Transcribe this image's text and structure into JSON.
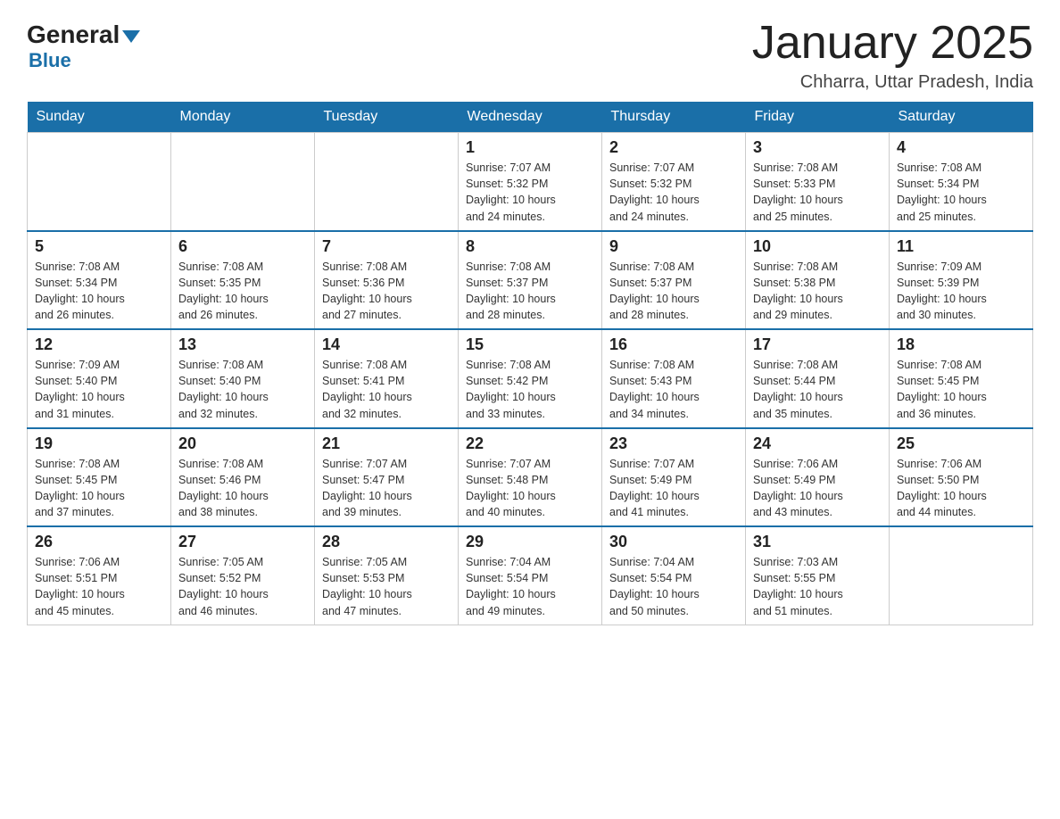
{
  "header": {
    "logo_general": "General",
    "logo_blue": "Blue",
    "month_title": "January 2025",
    "location": "Chharra, Uttar Pradesh, India"
  },
  "weekdays": [
    "Sunday",
    "Monday",
    "Tuesday",
    "Wednesday",
    "Thursday",
    "Friday",
    "Saturday"
  ],
  "weeks": [
    [
      {
        "day": "",
        "info": ""
      },
      {
        "day": "",
        "info": ""
      },
      {
        "day": "",
        "info": ""
      },
      {
        "day": "1",
        "info": "Sunrise: 7:07 AM\nSunset: 5:32 PM\nDaylight: 10 hours\nand 24 minutes."
      },
      {
        "day": "2",
        "info": "Sunrise: 7:07 AM\nSunset: 5:32 PM\nDaylight: 10 hours\nand 24 minutes."
      },
      {
        "day": "3",
        "info": "Sunrise: 7:08 AM\nSunset: 5:33 PM\nDaylight: 10 hours\nand 25 minutes."
      },
      {
        "day": "4",
        "info": "Sunrise: 7:08 AM\nSunset: 5:34 PM\nDaylight: 10 hours\nand 25 minutes."
      }
    ],
    [
      {
        "day": "5",
        "info": "Sunrise: 7:08 AM\nSunset: 5:34 PM\nDaylight: 10 hours\nand 26 minutes."
      },
      {
        "day": "6",
        "info": "Sunrise: 7:08 AM\nSunset: 5:35 PM\nDaylight: 10 hours\nand 26 minutes."
      },
      {
        "day": "7",
        "info": "Sunrise: 7:08 AM\nSunset: 5:36 PM\nDaylight: 10 hours\nand 27 minutes."
      },
      {
        "day": "8",
        "info": "Sunrise: 7:08 AM\nSunset: 5:37 PM\nDaylight: 10 hours\nand 28 minutes."
      },
      {
        "day": "9",
        "info": "Sunrise: 7:08 AM\nSunset: 5:37 PM\nDaylight: 10 hours\nand 28 minutes."
      },
      {
        "day": "10",
        "info": "Sunrise: 7:08 AM\nSunset: 5:38 PM\nDaylight: 10 hours\nand 29 minutes."
      },
      {
        "day": "11",
        "info": "Sunrise: 7:09 AM\nSunset: 5:39 PM\nDaylight: 10 hours\nand 30 minutes."
      }
    ],
    [
      {
        "day": "12",
        "info": "Sunrise: 7:09 AM\nSunset: 5:40 PM\nDaylight: 10 hours\nand 31 minutes."
      },
      {
        "day": "13",
        "info": "Sunrise: 7:08 AM\nSunset: 5:40 PM\nDaylight: 10 hours\nand 32 minutes."
      },
      {
        "day": "14",
        "info": "Sunrise: 7:08 AM\nSunset: 5:41 PM\nDaylight: 10 hours\nand 32 minutes."
      },
      {
        "day": "15",
        "info": "Sunrise: 7:08 AM\nSunset: 5:42 PM\nDaylight: 10 hours\nand 33 minutes."
      },
      {
        "day": "16",
        "info": "Sunrise: 7:08 AM\nSunset: 5:43 PM\nDaylight: 10 hours\nand 34 minutes."
      },
      {
        "day": "17",
        "info": "Sunrise: 7:08 AM\nSunset: 5:44 PM\nDaylight: 10 hours\nand 35 minutes."
      },
      {
        "day": "18",
        "info": "Sunrise: 7:08 AM\nSunset: 5:45 PM\nDaylight: 10 hours\nand 36 minutes."
      }
    ],
    [
      {
        "day": "19",
        "info": "Sunrise: 7:08 AM\nSunset: 5:45 PM\nDaylight: 10 hours\nand 37 minutes."
      },
      {
        "day": "20",
        "info": "Sunrise: 7:08 AM\nSunset: 5:46 PM\nDaylight: 10 hours\nand 38 minutes."
      },
      {
        "day": "21",
        "info": "Sunrise: 7:07 AM\nSunset: 5:47 PM\nDaylight: 10 hours\nand 39 minutes."
      },
      {
        "day": "22",
        "info": "Sunrise: 7:07 AM\nSunset: 5:48 PM\nDaylight: 10 hours\nand 40 minutes."
      },
      {
        "day": "23",
        "info": "Sunrise: 7:07 AM\nSunset: 5:49 PM\nDaylight: 10 hours\nand 41 minutes."
      },
      {
        "day": "24",
        "info": "Sunrise: 7:06 AM\nSunset: 5:49 PM\nDaylight: 10 hours\nand 43 minutes."
      },
      {
        "day": "25",
        "info": "Sunrise: 7:06 AM\nSunset: 5:50 PM\nDaylight: 10 hours\nand 44 minutes."
      }
    ],
    [
      {
        "day": "26",
        "info": "Sunrise: 7:06 AM\nSunset: 5:51 PM\nDaylight: 10 hours\nand 45 minutes."
      },
      {
        "day": "27",
        "info": "Sunrise: 7:05 AM\nSunset: 5:52 PM\nDaylight: 10 hours\nand 46 minutes."
      },
      {
        "day": "28",
        "info": "Sunrise: 7:05 AM\nSunset: 5:53 PM\nDaylight: 10 hours\nand 47 minutes."
      },
      {
        "day": "29",
        "info": "Sunrise: 7:04 AM\nSunset: 5:54 PM\nDaylight: 10 hours\nand 49 minutes."
      },
      {
        "day": "30",
        "info": "Sunrise: 7:04 AM\nSunset: 5:54 PM\nDaylight: 10 hours\nand 50 minutes."
      },
      {
        "day": "31",
        "info": "Sunrise: 7:03 AM\nSunset: 5:55 PM\nDaylight: 10 hours\nand 51 minutes."
      },
      {
        "day": "",
        "info": ""
      }
    ]
  ]
}
